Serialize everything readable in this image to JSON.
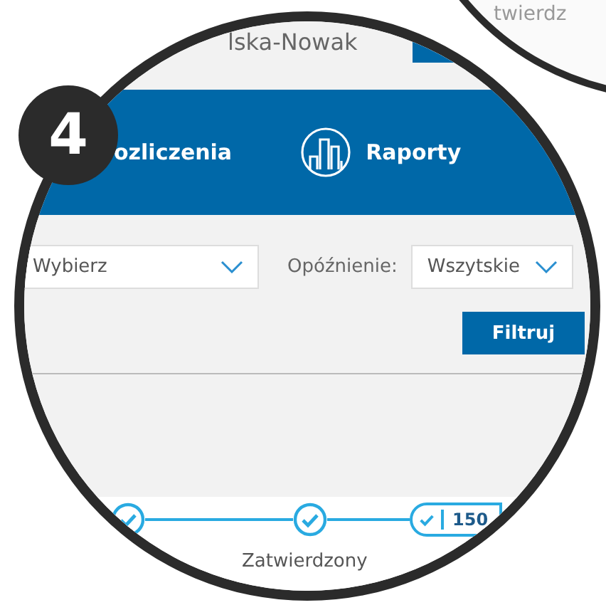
{
  "background_circle": {
    "text": "twierdz"
  },
  "header": {
    "user_name": "lska-Nowak"
  },
  "nav": [
    {
      "kind": "text",
      "label": "ozliczenia"
    },
    {
      "kind": "icon",
      "label": "Raporty"
    }
  ],
  "filters": {
    "select_1": {
      "value": "Wybierz"
    },
    "delay_label": "Opóźnienie:",
    "delay_select": {
      "value": "Wszytskie"
    },
    "button": "Filtruj"
  },
  "stepper": [
    {
      "done": true
    },
    {
      "done": true,
      "label": "Zatwierdzony"
    },
    {
      "done": true,
      "amount": "150"
    }
  ],
  "callout_number": "4"
}
